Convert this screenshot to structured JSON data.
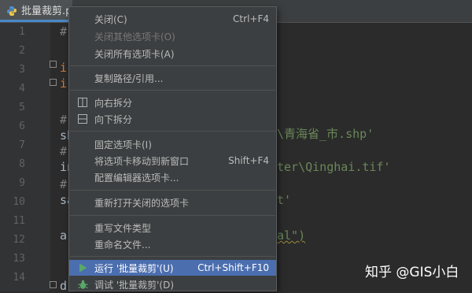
{
  "tab": {
    "label": "批量裁剪.p",
    "icon": "python-file-icon"
  },
  "line_numbers": [
    "1",
    "2",
    "3",
    "4",
    "5",
    "6",
    "7",
    "8",
    "9",
    "10",
    "11",
    "12",
    "13",
    "14",
    "15",
    "16"
  ],
  "code": {
    "l1": "#",
    "l4": "i",
    "l5": "i",
    "l7": "#",
    "l8a": "sh",
    "l8b": "\\青海省_市.shp'",
    "l9": "#",
    "l10a": "in",
    "l10b": "ter\\Qinghai.tif'",
    "l11": "#",
    "l12a": "sa",
    "l12b": "t'",
    "l14a": "a",
    "l14b": "al\")",
    "l17": "d"
  },
  "menu": {
    "close": {
      "label": "关闭(C)",
      "shortcut": "Ctrl+F4"
    },
    "close_others": {
      "label": "关闭其他选项卡(O)"
    },
    "close_all": {
      "label": "关闭所有选项卡(A)"
    },
    "copy_path": {
      "label": "复制路径/引用..."
    },
    "split_right": {
      "label": "向右拆分"
    },
    "split_down": {
      "label": "向下拆分"
    },
    "pin_tab": {
      "label": "固定选项卡(I)"
    },
    "move_to_new_window": {
      "label": "将选项卡移动到新窗口",
      "shortcut": "Shift+F4"
    },
    "configure_tabs": {
      "label": "配置编辑器选项卡..."
    },
    "reopen_closed": {
      "label": "重新打开关闭的选项卡"
    },
    "override_type": {
      "label": "重写文件类型"
    },
    "rename_file": {
      "label": "重命名文件..."
    },
    "run": {
      "label": "运行 '批量裁剪'(U)",
      "shortcut": "Ctrl+Shift+F10"
    },
    "debug": {
      "label": "调试 '批量裁剪'(D)"
    }
  },
  "watermark": "知乎 @GIS小白",
  "colors": {
    "accent": "#4b6eaf",
    "run_green": "#59a869",
    "background": "#2b2b2b",
    "menu_bg": "#3c3f41"
  }
}
